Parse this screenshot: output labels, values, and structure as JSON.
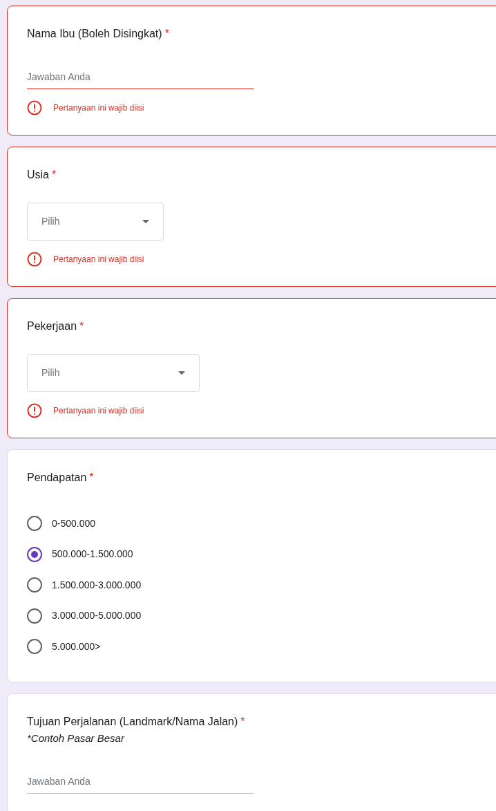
{
  "questions": [
    {
      "kind": "text",
      "title": "Nama Ibu (Boleh Disingkat)",
      "required_mark": "*",
      "placeholder": "Jawaban Anda",
      "error": "Pertanyaan ini wajib diisi"
    },
    {
      "kind": "select",
      "title": "Usia",
      "required_mark": "*",
      "placeholder": "Pilih",
      "error": "Pertanyaan ini wajib diisi"
    },
    {
      "kind": "select",
      "title": "Pekerjaan",
      "required_mark": "*",
      "placeholder": "Pilih",
      "error": "Pertanyaan ini wajib diisi"
    },
    {
      "kind": "radio",
      "title": "Pendapatan",
      "required_mark": "*",
      "options": [
        {
          "label": "0-500.000",
          "selected": false
        },
        {
          "label": "500.000-1.500.000",
          "selected": true
        },
        {
          "label": "1.500.000-3.000.000",
          "selected": false
        },
        {
          "label": "3.000.000-5.000.000",
          "selected": false
        },
        {
          "label": "5.000.000>",
          "selected": false
        }
      ]
    },
    {
      "kind": "text",
      "title": "Tujuan Perjalanan (Landmark/Nama Jalan)",
      "required_mark": "*",
      "description": "*Contoh Pasar Besar",
      "placeholder": "Jawaban Anda"
    }
  ]
}
